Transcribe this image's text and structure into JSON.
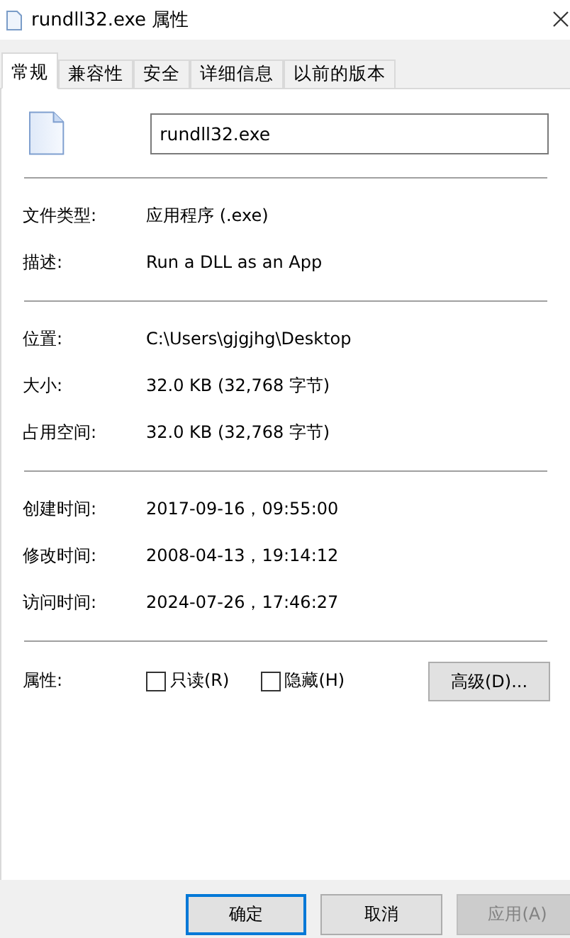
{
  "window": {
    "title": "rundll32.exe 属性"
  },
  "tabs": [
    {
      "label": "常规",
      "selected": true
    },
    {
      "label": "兼容性",
      "selected": false
    },
    {
      "label": "安全",
      "selected": false
    },
    {
      "label": "详细信息",
      "selected": false
    },
    {
      "label": "以前的版本",
      "selected": false
    }
  ],
  "file_name": "rundll32.exe",
  "groups": [
    [
      {
        "label": "文件类型:",
        "value": "应用程序 (.exe)"
      },
      {
        "label": "描述:",
        "value": "Run a DLL as an App"
      }
    ],
    [
      {
        "label": "位置:",
        "value": "C:\\Users\\gjgjhg\\Desktop"
      },
      {
        "label": "大小:",
        "value": "32.0 KB (32,768 字节)"
      },
      {
        "label": "占用空间:",
        "value": "32.0 KB (32,768 字节)"
      }
    ],
    [
      {
        "label": "创建时间:",
        "value": "2017-09-16，09:55:00"
      },
      {
        "label": "修改时间:",
        "value": "2008-04-13，19:14:12"
      },
      {
        "label": "访问时间:",
        "value": "2024-07-26，17:46:27"
      }
    ]
  ],
  "attributes": {
    "label": "属性:",
    "checkboxes": [
      {
        "label": "只读(R)",
        "checked": false
      },
      {
        "label": "隐藏(H)",
        "checked": false
      }
    ],
    "advanced": "高级(D)..."
  },
  "buttons": [
    {
      "label": "确定",
      "kind": "default",
      "disabled": false
    },
    {
      "label": "取消",
      "kind": "normal",
      "disabled": false
    },
    {
      "label": "应用(A)",
      "kind": "normal",
      "disabled": true
    }
  ]
}
